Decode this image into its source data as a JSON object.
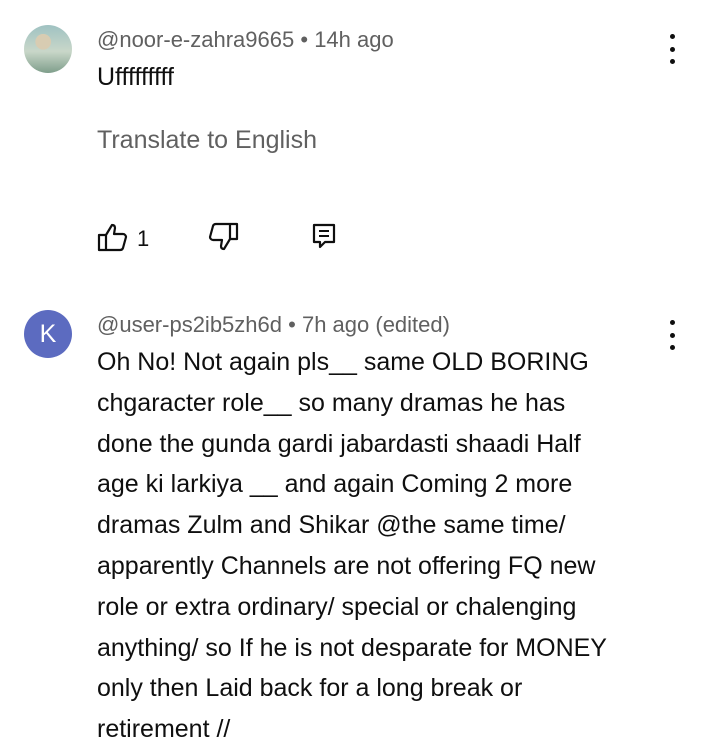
{
  "comments": [
    {
      "handle": "@noor-e-zahra9665",
      "separator": "•",
      "time": "14h ago",
      "edited": "",
      "text": "Ufffffffff",
      "translate_label": "Translate to English",
      "like_count": "1",
      "avatar_icon": "avatar-photo"
    },
    {
      "handle": "@user-ps2ib5zh6d",
      "separator": "•",
      "time": "7h ago",
      "edited": "(edited)",
      "avatar_letter": "K",
      "avatar_color": "#5c6bc0",
      "text_lines": [
        "Oh No! Not again pls__ same OLD BORING",
        "chgaracter role__ so many dramas he has",
        "done the gunda gardi jabardasti shaadi Half",
        "age ki larkiya __ and again Coming 2 more",
        "dramas Zulm and Shikar @the same time/",
        "apparently Channels are not offering FQ new",
        "role or extra ordinary/ special or chalenging",
        "anything/ so If he is not desparate for MONEY",
        "only then Laid back for a long break or",
        "retirement //"
      ]
    }
  ]
}
